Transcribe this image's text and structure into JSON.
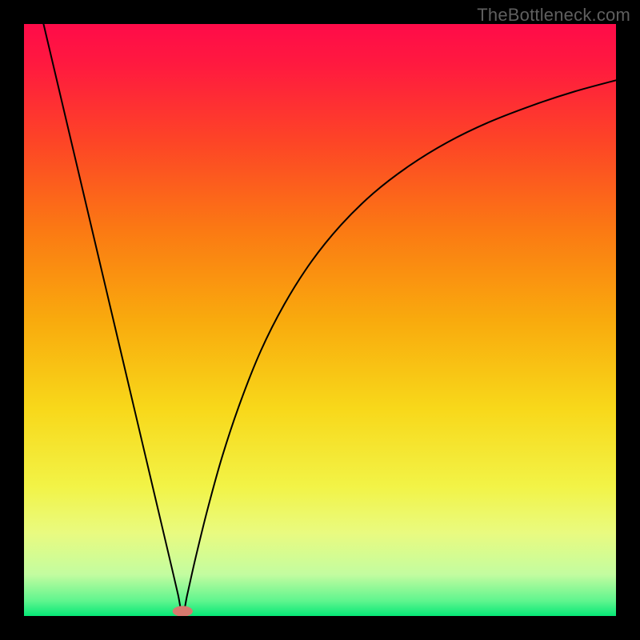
{
  "watermark": "TheBottleneck.com",
  "chart_data": {
    "type": "line",
    "title": "",
    "xlabel": "",
    "ylabel": "",
    "xlim": [
      0,
      1
    ],
    "ylim": [
      0,
      1
    ],
    "background": {
      "gradient_stops": [
        {
          "offset": 0.0,
          "color": "#ff0b49"
        },
        {
          "offset": 0.07,
          "color": "#ff1a3f"
        },
        {
          "offset": 0.2,
          "color": "#fd4526"
        },
        {
          "offset": 0.35,
          "color": "#fb7a13"
        },
        {
          "offset": 0.5,
          "color": "#f9aa0d"
        },
        {
          "offset": 0.65,
          "color": "#f8d81a"
        },
        {
          "offset": 0.78,
          "color": "#f2f346"
        },
        {
          "offset": 0.86,
          "color": "#e9fb80"
        },
        {
          "offset": 0.93,
          "color": "#c3fca0"
        },
        {
          "offset": 0.975,
          "color": "#5ef58e"
        },
        {
          "offset": 1.0,
          "color": "#06e876"
        }
      ]
    },
    "marker": {
      "x": 0.268,
      "y": 0.992,
      "rx": 0.017,
      "ry": 0.009,
      "fill": "#d77a6f"
    },
    "series": [
      {
        "name": "bottleneck-curve",
        "stroke": "#000000",
        "stroke_width": 2,
        "points": [
          {
            "x": 0.033,
            "y": 1.0
          },
          {
            "x": 0.05,
            "y": 0.928
          },
          {
            "x": 0.075,
            "y": 0.822
          },
          {
            "x": 0.1,
            "y": 0.716
          },
          {
            "x": 0.125,
            "y": 0.61
          },
          {
            "x": 0.15,
            "y": 0.504
          },
          {
            "x": 0.175,
            "y": 0.398
          },
          {
            "x": 0.2,
            "y": 0.292
          },
          {
            "x": 0.225,
            "y": 0.186
          },
          {
            "x": 0.25,
            "y": 0.08
          },
          {
            "x": 0.26,
            "y": 0.037
          },
          {
            "x": 0.268,
            "y": 0.003
          },
          {
            "x": 0.276,
            "y": 0.037
          },
          {
            "x": 0.29,
            "y": 0.099
          },
          {
            "x": 0.31,
            "y": 0.18
          },
          {
            "x": 0.335,
            "y": 0.27
          },
          {
            "x": 0.365,
            "y": 0.36
          },
          {
            "x": 0.4,
            "y": 0.448
          },
          {
            "x": 0.44,
            "y": 0.527
          },
          {
            "x": 0.485,
            "y": 0.598
          },
          {
            "x": 0.535,
            "y": 0.66
          },
          {
            "x": 0.59,
            "y": 0.714
          },
          {
            "x": 0.65,
            "y": 0.76
          },
          {
            "x": 0.715,
            "y": 0.8
          },
          {
            "x": 0.785,
            "y": 0.834
          },
          {
            "x": 0.86,
            "y": 0.863
          },
          {
            "x": 0.93,
            "y": 0.886
          },
          {
            "x": 1.0,
            "y": 0.905
          }
        ]
      }
    ]
  }
}
